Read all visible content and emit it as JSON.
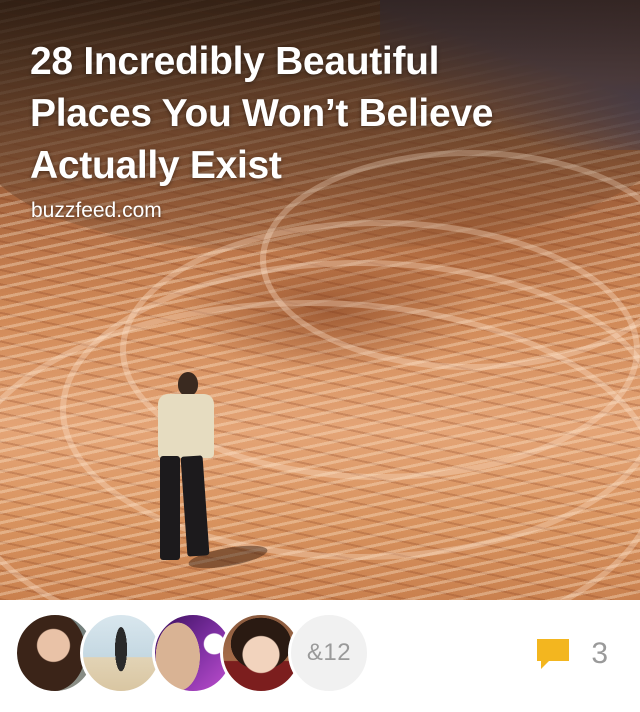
{
  "card": {
    "title_lines": [
      "28 Incredibly Beautiful",
      "Places You Won’t Believe",
      "Actually Exist"
    ],
    "source": "buzzfeed.com",
    "image_icon": "landscape-photo"
  },
  "footer": {
    "avatars": [
      {
        "icon": "avatar-photo"
      },
      {
        "icon": "avatar-photo"
      },
      {
        "icon": "avatar-photo"
      },
      {
        "icon": "avatar-photo"
      }
    ],
    "more_count_label": "&12",
    "comment_icon": "speech-bubble-icon",
    "comment_count": "3"
  },
  "colors": {
    "accent": "#f3b61f",
    "muted_text": "#9a9a9a",
    "background": "#ffffff"
  }
}
